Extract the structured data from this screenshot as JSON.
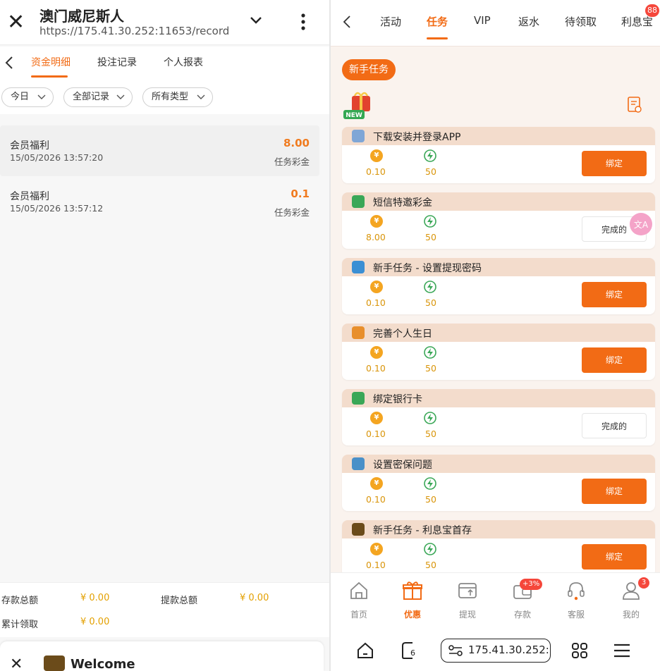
{
  "left": {
    "title": "澳门威尼斯人",
    "url": "https://175.41.30.252:11653/record",
    "tabs": [
      "资金明细",
      "投注记录",
      "个人报表"
    ],
    "filters": [
      "今日",
      "全部记录",
      "所有类型"
    ],
    "records": [
      {
        "title": "会员福利",
        "time": "15/05/2026 13:57:20",
        "amount": "8.00",
        "type": "任务彩金"
      },
      {
        "title": "会员福利",
        "time": "15/05/2026 13:57:12",
        "amount": "0.1",
        "type": "任务彩金"
      }
    ],
    "summary": {
      "deposit_label": "存款总额",
      "deposit_value": "¥ 0.00",
      "withdraw_label": "提款总额",
      "withdraw_value": "¥ 0.00",
      "claimed_label": "累计领取",
      "claimed_value": "¥ 0.00"
    },
    "bottom": {
      "text": "Welcome"
    }
  },
  "right": {
    "tabs": [
      "活动",
      "任务",
      "VIP",
      "返水",
      "待领取",
      "利息宝"
    ],
    "tab_badge": "88",
    "section_label": "新手任务",
    "new_tag": "NEW",
    "tasks": [
      {
        "title": "下载安装并登录APP",
        "value1": "0.10",
        "value2": "50",
        "button": "绑定",
        "state": "bind",
        "icon": "phone-icon"
      },
      {
        "title": "短信特邀彩金",
        "value1": "8.00",
        "value2": "50",
        "button": "完成的",
        "state": "done",
        "icon": "sms-icon"
      },
      {
        "title": "新手任务 - 设置提现密码",
        "value1": "0.10",
        "value2": "50",
        "button": "绑定",
        "state": "bind",
        "icon": "globe-icon"
      },
      {
        "title": "完善个人生日",
        "value1": "0.10",
        "value2": "50",
        "button": "绑定",
        "state": "bind",
        "icon": "cake-icon"
      },
      {
        "title": "绑定银行卡",
        "value1": "0.10",
        "value2": "50",
        "button": "完成的",
        "state": "done",
        "icon": "card-icon"
      },
      {
        "title": "设置密保问题",
        "value1": "0.10",
        "value2": "50",
        "button": "绑定",
        "state": "bind",
        "icon": "book-icon"
      },
      {
        "title": "新手任务 - 利息宝首存",
        "value1": "0.10",
        "value2": "50",
        "button": "绑定",
        "state": "bind",
        "icon": "treasure-icon"
      }
    ],
    "coin_symbol": "¥",
    "nav": [
      {
        "label": "首页",
        "icon": "home-icon"
      },
      {
        "label": "优惠",
        "icon": "gift-icon"
      },
      {
        "label": "提现",
        "icon": "withdraw-icon"
      },
      {
        "label": "存款",
        "icon": "wallet-icon",
        "badge": "+3%"
      },
      {
        "label": "客服",
        "icon": "support-icon"
      },
      {
        "label": "我的",
        "icon": "profile-icon",
        "badge": "3"
      }
    ],
    "browser": {
      "url": "175.41.30.252:",
      "tab_count": "6"
    },
    "colors": {
      "accent": "#f26b15",
      "amount": "#f07b1f",
      "task_header": "#f3dccc",
      "badge": "#f5473b"
    }
  }
}
